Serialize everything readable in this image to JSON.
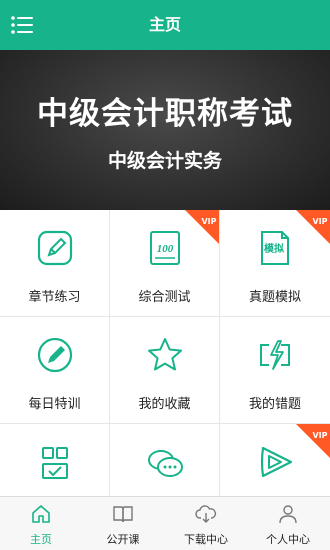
{
  "header": {
    "title": "主页",
    "menu_icon": "menu-list-icon"
  },
  "banner": {
    "title": "中级会计职称考试",
    "subtitle": "中级会计实务"
  },
  "colors": {
    "accent": "#17b38a",
    "vip": "#ff5a26"
  },
  "vip_label": "VIP",
  "grid": {
    "items": [
      {
        "label": "章节练习",
        "icon": "pencil-edit-icon",
        "vip": false
      },
      {
        "label": "综合测试",
        "icon": "test-100-icon",
        "vip": true
      },
      {
        "label": "真题模拟",
        "icon": "mock-exam-icon",
        "vip": true
      },
      {
        "label": "每日特训",
        "icon": "pencil-circle-icon",
        "vip": false
      },
      {
        "label": "我的收藏",
        "icon": "star-icon",
        "vip": false
      },
      {
        "label": "我的错题",
        "icon": "error-bolt-icon",
        "vip": false
      },
      {
        "label": "",
        "icon": "checklist-icon",
        "vip": false
      },
      {
        "label": "",
        "icon": "chat-bubbles-icon",
        "vip": false
      },
      {
        "label": "",
        "icon": "play-icon",
        "vip": true
      }
    ]
  },
  "tabbar": {
    "items": [
      {
        "label": "主页",
        "icon": "home-icon",
        "active": true
      },
      {
        "label": "公开课",
        "icon": "book-icon",
        "active": false
      },
      {
        "label": "下载中心",
        "icon": "cloud-download-icon",
        "active": false
      },
      {
        "label": "个人中心",
        "icon": "user-icon",
        "active": false
      }
    ]
  }
}
